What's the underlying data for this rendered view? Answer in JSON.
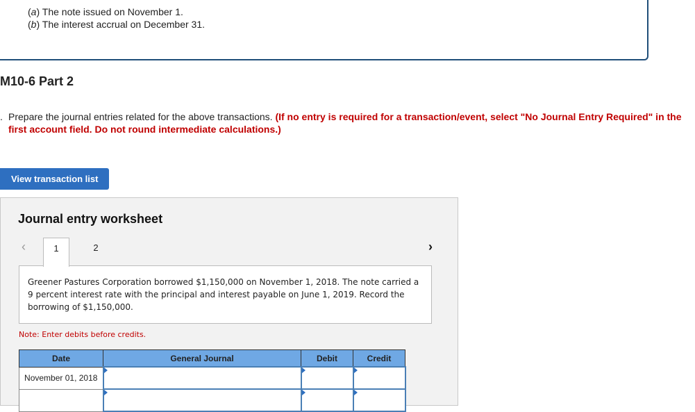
{
  "previous": {
    "items": [
      {
        "label": "a",
        "text": " The note issued on November 1."
      },
      {
        "label": "b",
        "text": " The interest accrual on December 31."
      }
    ]
  },
  "part_title": "M10-6 Part 2",
  "instructions": {
    "bullet": ".",
    "text": "Prepare the journal entries related for the above transactions. ",
    "red_text": "(If no entry is required for a transaction/event, select \"No Journal Entry Required\" in the first account field. Do not round intermediate calculations.)"
  },
  "view_button": "View transaction list",
  "worksheet": {
    "title": "Journal entry worksheet",
    "tabs": [
      "1",
      "2"
    ],
    "active_tab": "1",
    "prev_icon": "‹",
    "next_icon": "›",
    "description": "Greener Pastures Corporation borrowed $1,150,000 on November 1, 2018. The note carried a 9 percent interest rate with the principal and interest payable on June 1, 2019. Record the borrowing of $1,150,000.",
    "note": "Note: Enter debits before credits.",
    "table": {
      "headers": [
        "Date",
        "General Journal",
        "Debit",
        "Credit"
      ],
      "rows": [
        {
          "date": "November 01, 2018",
          "account": "",
          "debit": "",
          "credit": ""
        },
        {
          "date": "",
          "account": "",
          "debit": "",
          "credit": ""
        }
      ]
    }
  }
}
